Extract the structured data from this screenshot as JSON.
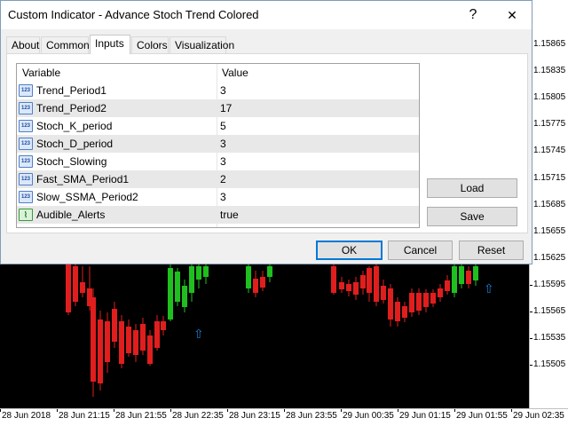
{
  "window": {
    "title": "Custom Indicator - Advance Stoch Trend Colored",
    "help_glyph": "?",
    "close_glyph": "✕"
  },
  "tabs": [
    {
      "label": "About"
    },
    {
      "label": "Common"
    },
    {
      "label": "Inputs"
    },
    {
      "label": "Colors"
    },
    {
      "label": "Visualization"
    }
  ],
  "active_tab": "Inputs",
  "grid": {
    "headers": {
      "variable": "Variable",
      "value": "Value"
    },
    "rows": [
      {
        "icon": "integer-icon",
        "icon_text": "123",
        "name": "Trend_Period1",
        "value": "3"
      },
      {
        "icon": "integer-icon",
        "icon_text": "123",
        "name": "Trend_Period2",
        "value": "17"
      },
      {
        "icon": "integer-icon",
        "icon_text": "123",
        "name": "Stoch_K_period",
        "value": "5"
      },
      {
        "icon": "integer-icon",
        "icon_text": "123",
        "name": "Stoch_D_period",
        "value": "3"
      },
      {
        "icon": "integer-icon",
        "icon_text": "123",
        "name": "Stoch_Slowing",
        "value": "3"
      },
      {
        "icon": "integer-icon",
        "icon_text": "123",
        "name": "Fast_SMA_Period1",
        "value": "2"
      },
      {
        "icon": "integer-icon",
        "icon_text": "123",
        "name": "Slow_SSMA_Period2",
        "value": "3"
      },
      {
        "icon": "boolean-icon",
        "icon_text": "⌇",
        "name": "Audible_Alerts",
        "value": "true"
      }
    ]
  },
  "buttons": {
    "load": "Load",
    "save": "Save",
    "ok": "OK",
    "cancel": "Cancel",
    "reset": "Reset"
  },
  "chart": {
    "price_labels": [
      "1.15865",
      "1.15835",
      "1.15805",
      "1.15775",
      "1.15745",
      "1.15715",
      "1.15685",
      "1.15655",
      "1.15625",
      "1.15595",
      "1.15565",
      "1.15535",
      "1.15505"
    ],
    "time_labels": [
      "28 Jun 2018",
      "28 Jun 21:15",
      "28 Jun 21:55",
      "28 Jun 22:35",
      "28 Jun 23:15",
      "28 Jun 23:55",
      "29 Jun 00:35",
      "29 Jun 01:15",
      "29 Jun 01:55",
      "29 Jun 02:35"
    ],
    "colors": {
      "bull": "#1fbf1f",
      "bear": "#e01e1e",
      "signal_arrow": "#1e7fd6"
    },
    "arrow_glyph": "⇧"
  }
}
